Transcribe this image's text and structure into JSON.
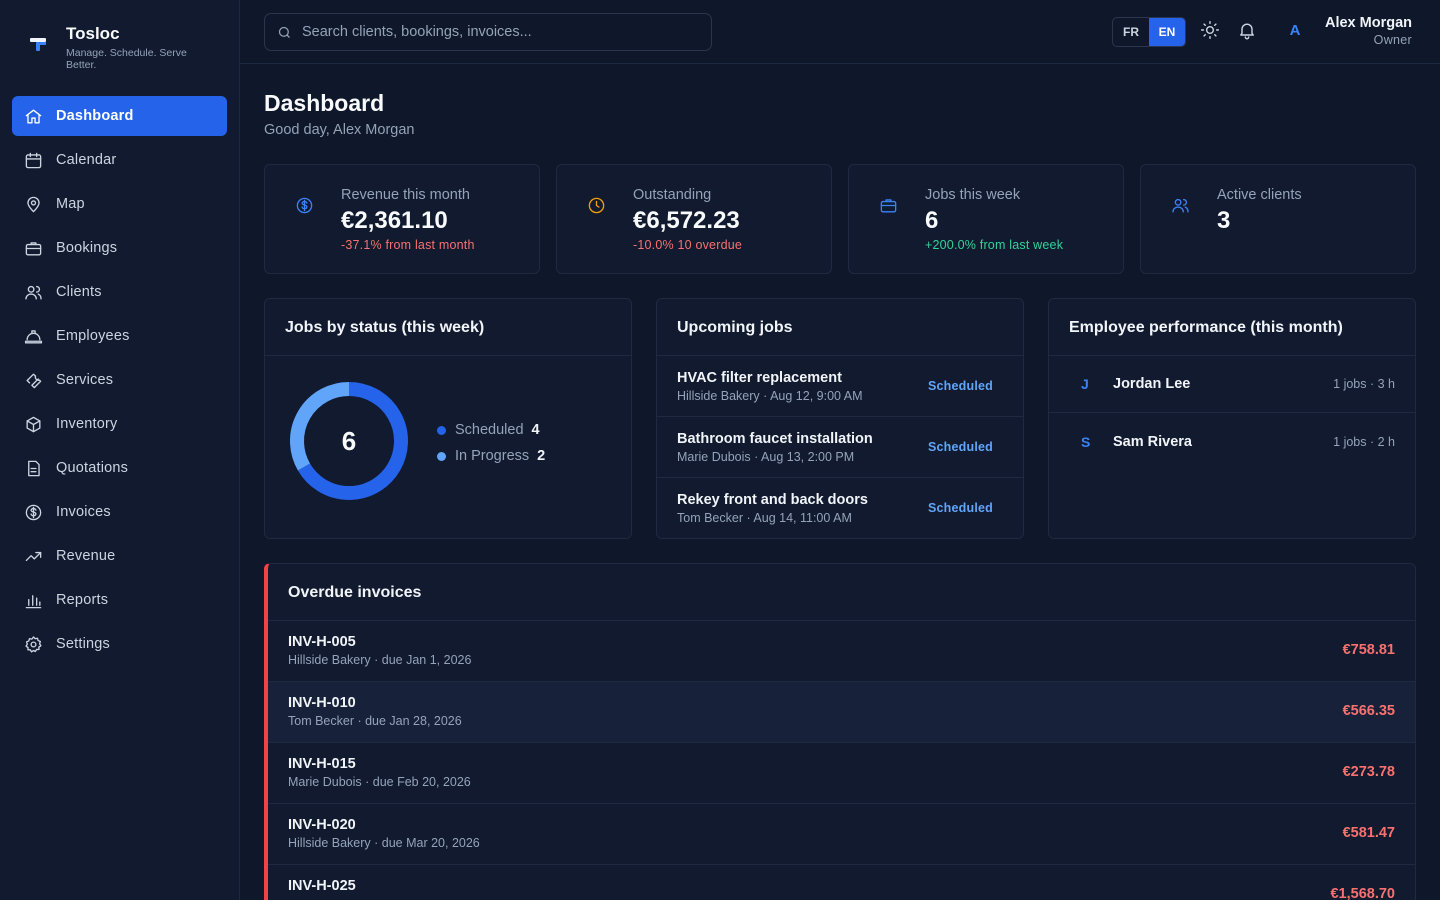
{
  "brand": {
    "name": "Tosloc",
    "tagline": "Manage. Schedule. Serve Better."
  },
  "nav": [
    {
      "label": "Dashboard",
      "icon": "home-icon",
      "active": true
    },
    {
      "label": "Calendar",
      "icon": "calendar-icon"
    },
    {
      "label": "Map",
      "icon": "map-pin-icon"
    },
    {
      "label": "Bookings",
      "icon": "briefcase-icon"
    },
    {
      "label": "Clients",
      "icon": "users-icon"
    },
    {
      "label": "Employees",
      "icon": "hard-hat-icon"
    },
    {
      "label": "Services",
      "icon": "wrench-icon"
    },
    {
      "label": "Inventory",
      "icon": "package-icon"
    },
    {
      "label": "Quotations",
      "icon": "document-icon"
    },
    {
      "label": "Invoices",
      "icon": "dollar-circle-icon"
    },
    {
      "label": "Revenue",
      "icon": "trending-up-icon"
    },
    {
      "label": "Reports",
      "icon": "bar-chart-icon"
    },
    {
      "label": "Settings",
      "icon": "gear-icon"
    }
  ],
  "topbar": {
    "search_placeholder": "Search clients, bookings, invoices...",
    "lang_fr": "FR",
    "lang_en": "EN",
    "lang_active": "EN",
    "avatar_initial": "A",
    "user_name": "Alex Morgan",
    "user_role": "Owner"
  },
  "page": {
    "title": "Dashboard",
    "greeting": "Good day, Alex Morgan"
  },
  "stats": [
    {
      "label": "Revenue this month",
      "value": "€2,361.10",
      "delta": "-37.1% from last month",
      "trend": "down",
      "icon": "dollar-circle-icon",
      "color": "#3b82f6"
    },
    {
      "label": "Outstanding",
      "value": "€6,572.23",
      "delta": "-10.0% 10 overdue",
      "trend": "down",
      "icon": "clock-icon",
      "color": "#f59e0b"
    },
    {
      "label": "Jobs this week",
      "value": "6",
      "delta": "+200.0% from last week",
      "trend": "up",
      "icon": "briefcase-icon",
      "color": "#3b82f6"
    },
    {
      "label": "Active clients",
      "value": "3",
      "delta": "",
      "trend": "none",
      "icon": "users-icon",
      "color": "#3b82f6"
    }
  ],
  "jobs_status": {
    "title": "Jobs by status (this week)",
    "total": "6",
    "legend": [
      {
        "label": "Scheduled",
        "value": "4",
        "color": "#2563eb"
      },
      {
        "label": "In Progress",
        "value": "2",
        "color": "#60a5fa"
      }
    ]
  },
  "chart_data": {
    "type": "pie",
    "categories": [
      "Scheduled",
      "In Progress"
    ],
    "values": [
      4,
      2
    ],
    "colors": [
      "#2563eb",
      "#60a5fa"
    ],
    "center_label": "6"
  },
  "upcoming": {
    "title": "Upcoming jobs",
    "items": [
      {
        "title": "HVAC filter replacement",
        "meta": "Hillside Bakery · Aug 12, 9:00 AM",
        "status": "Scheduled"
      },
      {
        "title": "Bathroom faucet installation",
        "meta": "Marie Dubois · Aug 13, 2:00 PM",
        "status": "Scheduled"
      },
      {
        "title": "Rekey front and back doors",
        "meta": "Tom Becker · Aug 14, 11:00 AM",
        "status": "Scheduled"
      }
    ]
  },
  "employees": {
    "title": "Employee performance (this month)",
    "items": [
      {
        "initial": "J",
        "name": "Jordan Lee",
        "stats": "1 jobs · 3 h"
      },
      {
        "initial": "S",
        "name": "Sam Rivera",
        "stats": "1 jobs · 2 h"
      }
    ]
  },
  "overdue": {
    "title": "Overdue invoices",
    "items": [
      {
        "id": "INV-H-005",
        "meta": "Hillside Bakery · due Jan 1, 2026",
        "amount": "€758.81"
      },
      {
        "id": "INV-H-010",
        "meta": "Tom Becker · due Jan 28, 2026",
        "amount": "€566.35"
      },
      {
        "id": "INV-H-015",
        "meta": "Marie Dubois · due Feb 20, 2026",
        "amount": "€273.78"
      },
      {
        "id": "INV-H-020",
        "meta": "Hillside Bakery · due Mar 20, 2026",
        "amount": "€581.47"
      },
      {
        "id": "INV-H-025",
        "meta": "",
        "amount": "€1,568.70"
      }
    ]
  }
}
